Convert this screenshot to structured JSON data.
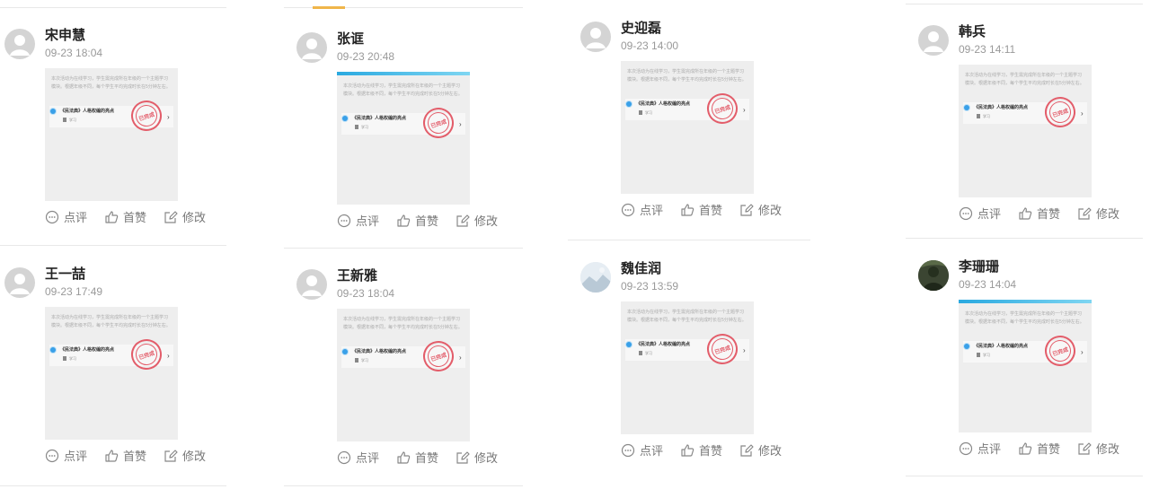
{
  "actions": {
    "comment_label": "点评",
    "like_label": "首赞",
    "edit_label": "修改"
  },
  "thumbnail": {
    "description": "本次活动为在线学习，学生需完成所在年级的一个主题学习模块。根据年级不同，每个学生平均完成时长在5分钟左右。",
    "task_title": "《民法典》人格权编的亮点",
    "task_meta": "学习",
    "stamp_text": "已完成"
  },
  "colors": {
    "accent_bar": "#2aa9e0",
    "stamp": "#e35d6a"
  },
  "posts": [
    {
      "name": "宋申慧",
      "time": "09-23 18:04",
      "avatar": "default-avatar-icon"
    },
    {
      "name": "王一喆",
      "time": "09-23 17:49",
      "avatar": "default-avatar-icon"
    },
    {
      "name": "张诓",
      "time": "09-23 20:48",
      "avatar": "default-avatar-icon"
    },
    {
      "name": "王新雅",
      "time": "09-23 18:04",
      "avatar": "default-avatar-icon"
    },
    {
      "name": "史迎磊",
      "time": "09-23 14:00",
      "avatar": "default-avatar-icon"
    },
    {
      "name": "魏佳润",
      "time": "09-23 13:59",
      "avatar": "photo-avatar"
    },
    {
      "name": "韩兵",
      "time": "09-23 14:11",
      "avatar": "default-avatar-icon"
    },
    {
      "name": "李珊珊",
      "time": "09-23 14:04",
      "avatar": "photo-avatar"
    }
  ]
}
